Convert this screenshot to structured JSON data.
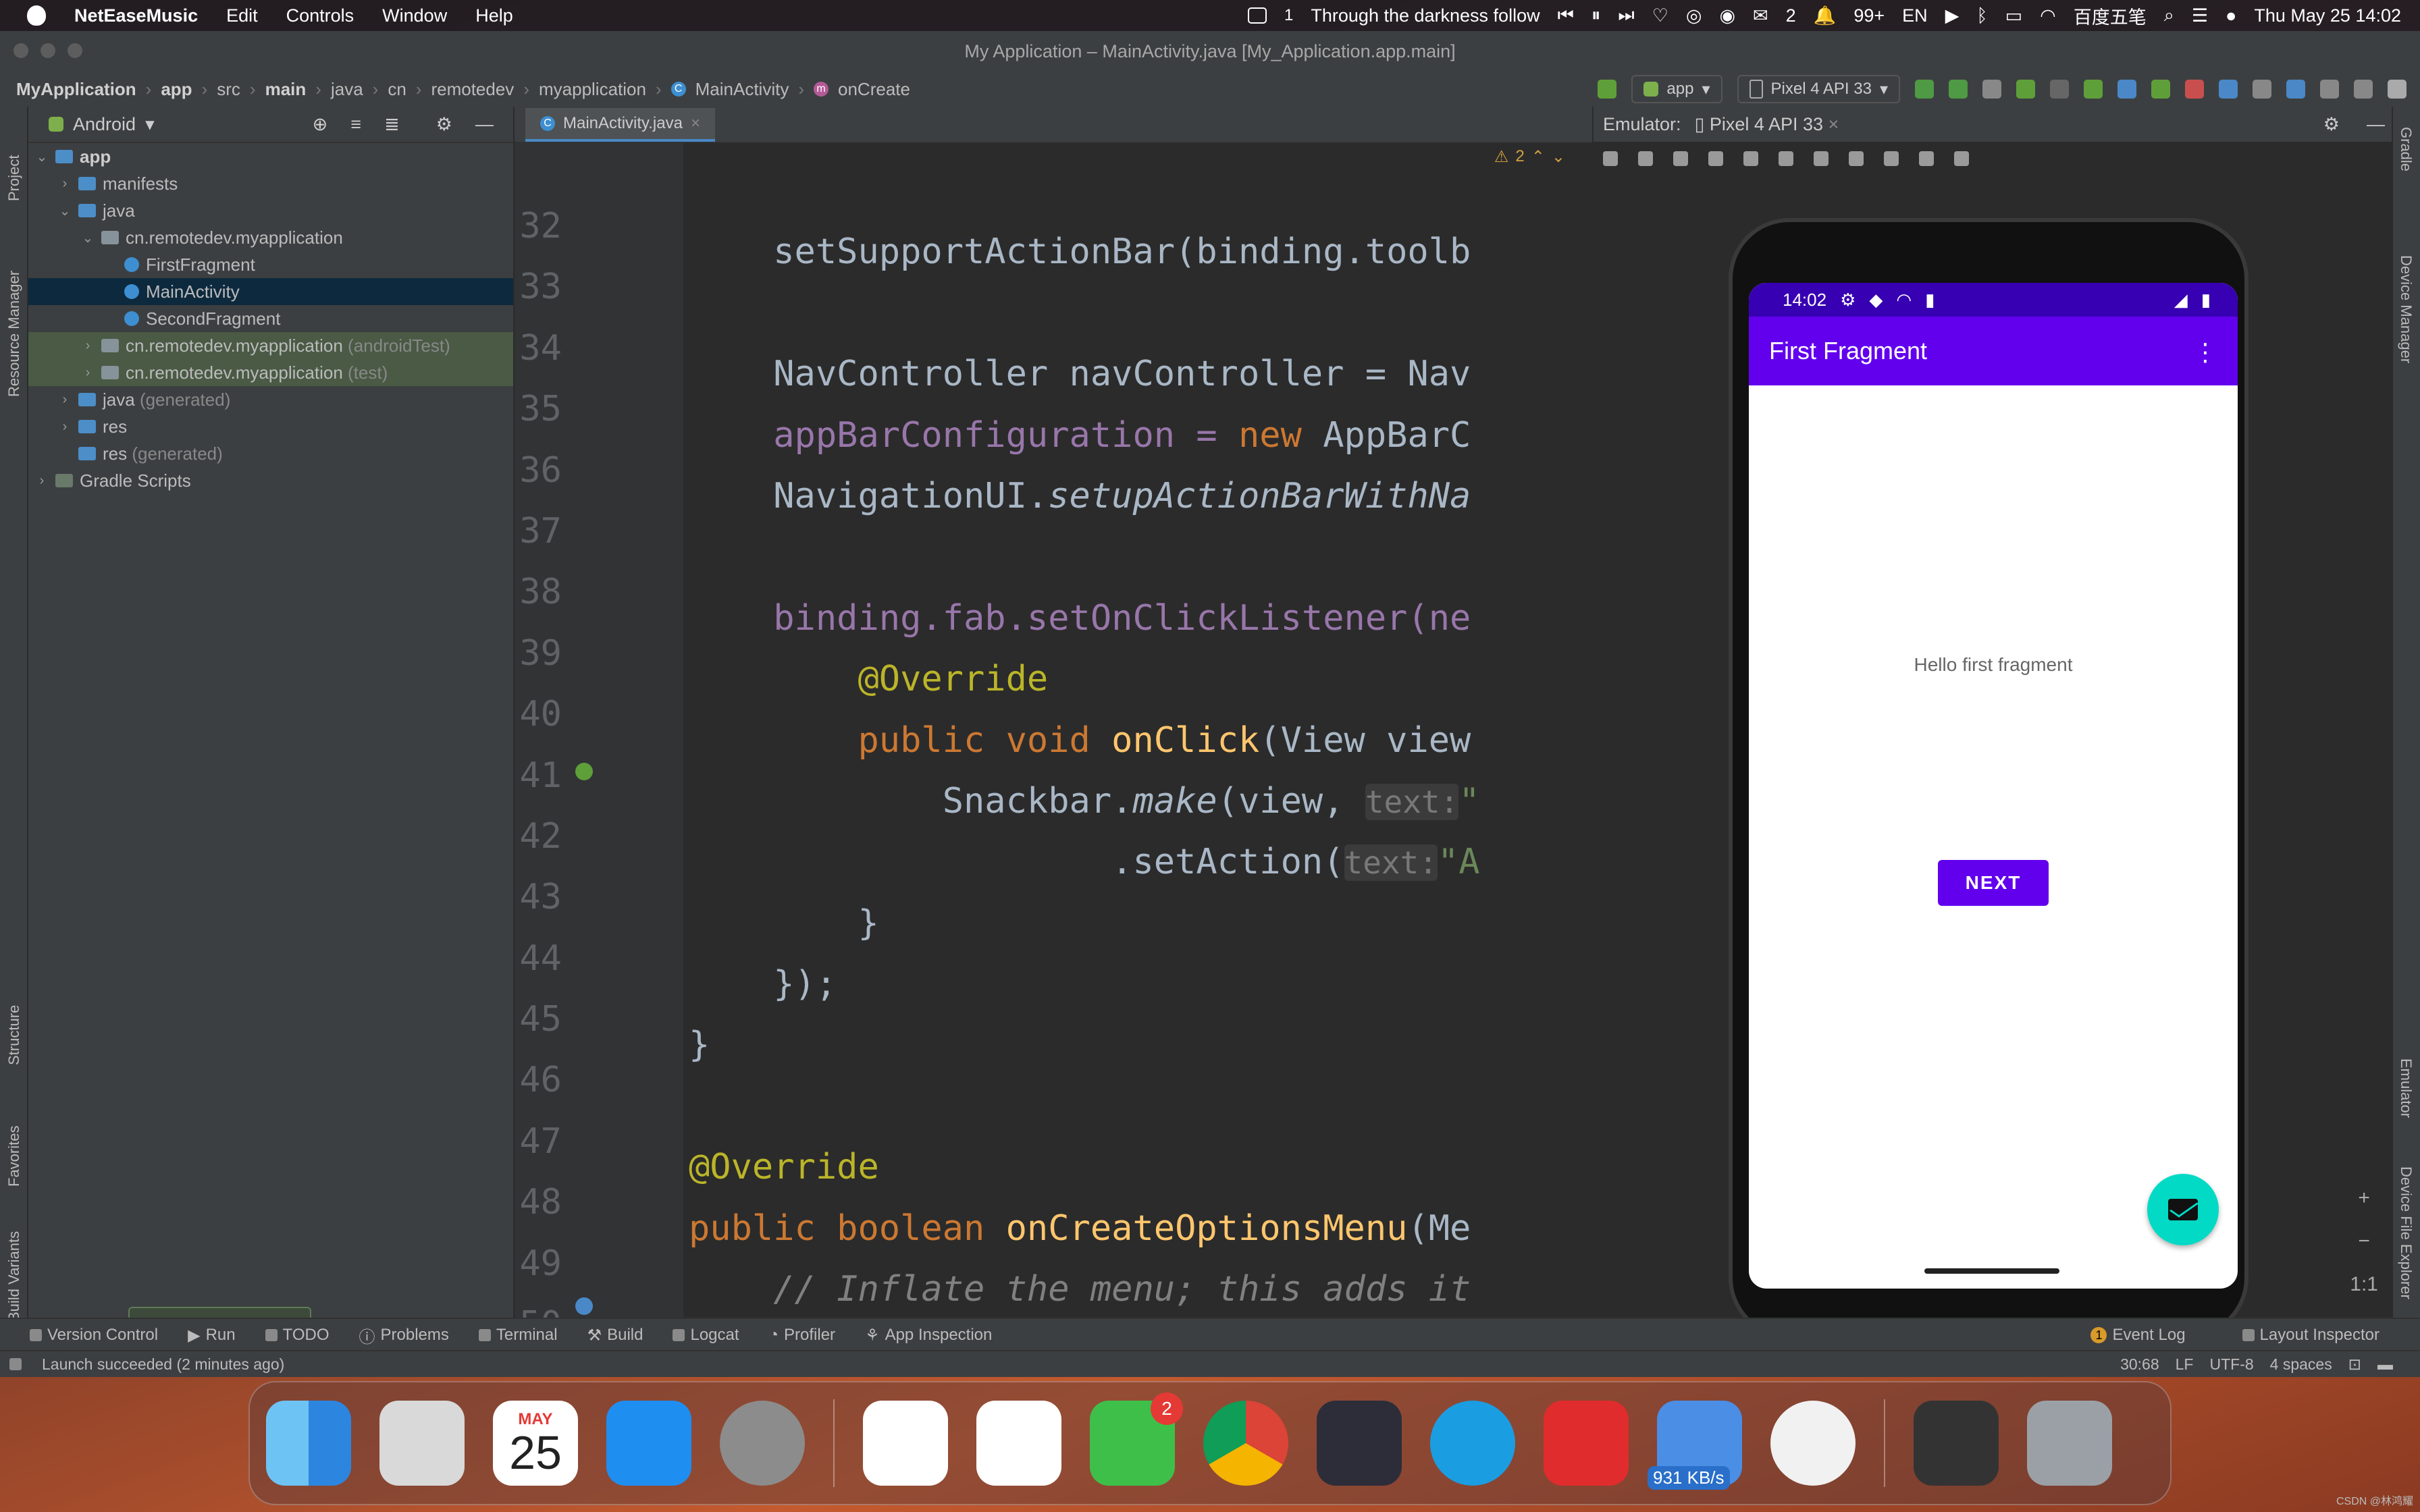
{
  "menubar": {
    "app_name": "NetEaseMusic",
    "menus": [
      "Edit",
      "Controls",
      "Window",
      "Help"
    ],
    "now_playing": "Through the darkness follow",
    "tray_count_1": "1",
    "wechat_count": "2",
    "notif_count": "99+",
    "lang": "EN",
    "ime": "百度五笔",
    "datetime": "Thu May 25  14:02"
  },
  "window": {
    "title": "My Application – MainActivity.java [My_Application.app.main]"
  },
  "breadcrumb": [
    "MyApplication",
    "app",
    "src",
    "main",
    "java",
    "cn",
    "remotedev",
    "myapplication",
    "MainActivity",
    "onCreate"
  ],
  "run_config": {
    "module": "app",
    "device": "Pixel 4 API 33"
  },
  "left_strip": {
    "project": "Project",
    "resource_manager": "Resource Manager",
    "structure": "Structure",
    "favorites": "Favorites",
    "build_variants": "Build Variants"
  },
  "right_strip": {
    "gradle": "Gradle",
    "device_manager": "Device Manager",
    "emulator": "Emulator",
    "device_file_explorer": "Device File Explorer"
  },
  "project_panel": {
    "view": "Android",
    "tree": [
      {
        "label": "app",
        "suffix": ""
      },
      {
        "label": "manifests",
        "suffix": ""
      },
      {
        "label": "java",
        "suffix": ""
      },
      {
        "label": "cn.remotedev.myapplication",
        "suffix": ""
      },
      {
        "label": "FirstFragment",
        "suffix": ""
      },
      {
        "label": "MainActivity",
        "suffix": ""
      },
      {
        "label": "SecondFragment",
        "suffix": ""
      },
      {
        "label": "cn.remotedev.myapplication",
        "suffix": "(androidTest)"
      },
      {
        "label": "cn.remotedev.myapplication",
        "suffix": "(test)"
      },
      {
        "label": "java",
        "suffix": "(generated)"
      },
      {
        "label": "res",
        "suffix": ""
      },
      {
        "label": "res",
        "suffix": "(generated)"
      },
      {
        "label": "Gradle Scripts",
        "suffix": ""
      }
    ],
    "toast": "Launch succeeded"
  },
  "editor": {
    "tab": "MainActivity.java",
    "warnings": "2",
    "line_numbers": [
      "32",
      "33",
      "34",
      "35",
      "36",
      "37",
      "38",
      "39",
      "40",
      "41",
      "42",
      "43",
      "44",
      "45",
      "46",
      "47",
      "48",
      "49",
      "50"
    ],
    "lines": {
      "l33": "setSupportActionBar(binding.toolb",
      "l35": "NavController navController = Nav",
      "l36a": "appBarConfiguration = ",
      "l36b": "new",
      "l36c": " AppBarC",
      "l37a": "NavigationUI.",
      "l37b": "setupActionBarWithNa",
      "l39": "binding.fab.setOnClickListener(ne",
      "l40": "@Override",
      "l41a": "public void ",
      "l41b": "onClick",
      "l41c": "(View view",
      "l42a": "Snackbar.",
      "l42b": "make",
      "l42c": "(view, ",
      "l42hint": "text:",
      "l42d": "\"",
      "l43a": ".setAction(",
      "l43hint": "text:",
      "l43b": "\"A",
      "l44": "}",
      "l45": "});",
      "l46": "}",
      "l48": "@Override",
      "l49a": "public boolean ",
      "l49b": "onCreateOptionsMenu",
      "l49c": "(Me",
      "l50": "// Inflate the menu; this adds it"
    }
  },
  "emulator": {
    "label": "Emulator:",
    "tab": "Pixel 4 API 33",
    "phone": {
      "time": "14:02",
      "title": "First Fragment",
      "hello": "Hello first fragment",
      "next": "NEXT"
    },
    "zoom_ratio": "1:1"
  },
  "toolwindows": [
    "Version Control",
    "Run",
    "TODO",
    "Problems",
    "Terminal",
    "Build",
    "Logcat",
    "Profiler",
    "App Inspection"
  ],
  "toolwindows_right": [
    "Event Log",
    "Layout Inspector"
  ],
  "event_count": "1",
  "statusbar": {
    "message": "Launch succeeded (2 minutes ago)",
    "position": "30:68",
    "line_sep": "LF",
    "encoding": "UTF-8",
    "indent": "4 spaces"
  },
  "dock": {
    "calendar_month": "MAY",
    "calendar_day": "25",
    "wechat_badge": "2",
    "net_speed": "931 KB/s"
  },
  "watermark": "CSDN @林鸿耀"
}
